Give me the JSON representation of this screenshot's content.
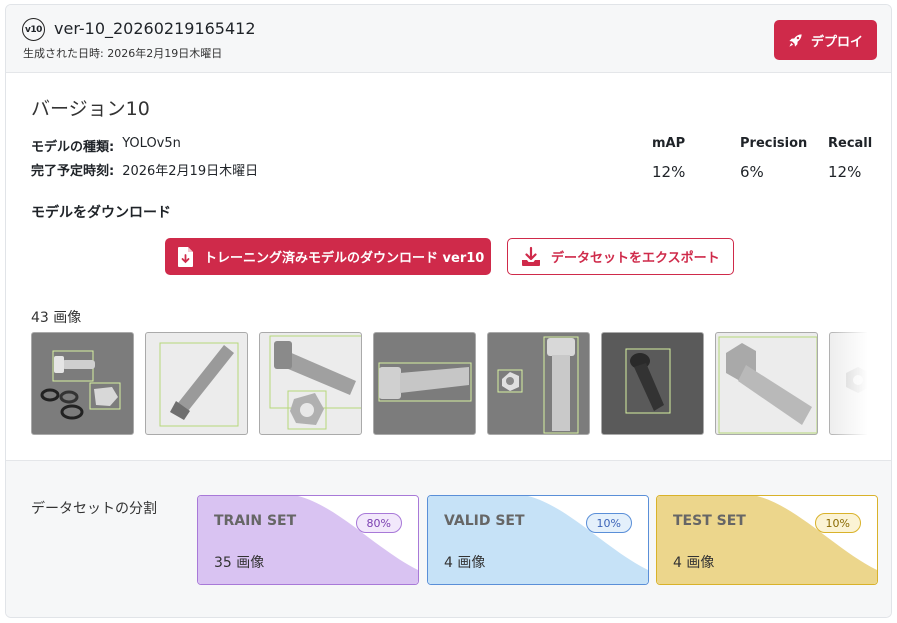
{
  "header": {
    "badge": "v10",
    "title": "ver-10_20260219165412",
    "generated": "生成された日時: 2026年2月19日木曜日",
    "deploy_label": "デプロイ"
  },
  "version": {
    "name": "バージョン10",
    "model_type_key": "モデルの種類:",
    "model_type_value": "YOLOv5n",
    "eta_key": "完了予定時刻:",
    "eta_value": "2026年2月19日木曜日"
  },
  "metrics": [
    {
      "label": "mAP",
      "value": "12%"
    },
    {
      "label": "Precision",
      "value": "6%"
    },
    {
      "label": "Recall",
      "value": "12%"
    }
  ],
  "download": {
    "title": "モデルをダウンロード",
    "model_button": "トレーニング済みモデルのダウンロード ver10",
    "export_button": "データセットをエクスポート"
  },
  "images": {
    "count_label": "43 画像",
    "thumbnails": [
      {
        "icon": "bolt-nut-washer-image"
      },
      {
        "icon": "hex-bolt-image"
      },
      {
        "icon": "bolt-and-nut-image"
      },
      {
        "icon": "bolt-horizontal-image"
      },
      {
        "icon": "bolt-vertical-nut-image"
      },
      {
        "icon": "socket-screw-image"
      },
      {
        "icon": "large-bolt-image"
      },
      {
        "icon": "nut-image"
      }
    ]
  },
  "split": {
    "label": "データセットの分割",
    "sets": [
      {
        "name": "TRAIN SET",
        "percent": "80%",
        "count": "35 画像",
        "color": "#d9c3f2",
        "border": "#a879d8",
        "badge_color": "#7a3fb0"
      },
      {
        "name": "VALID SET",
        "percent": "10%",
        "count": "4 画像",
        "color": "#c6e2f7",
        "border": "#5a8fd8",
        "badge_color": "#3b63b8"
      },
      {
        "name": "TEST SET",
        "percent": "10%",
        "count": "4 画像",
        "color": "#ecd68c",
        "border": "#d9b22a",
        "badge_color": "#8a6a00"
      }
    ]
  },
  "colors": {
    "accent": "#cf2a4a"
  }
}
